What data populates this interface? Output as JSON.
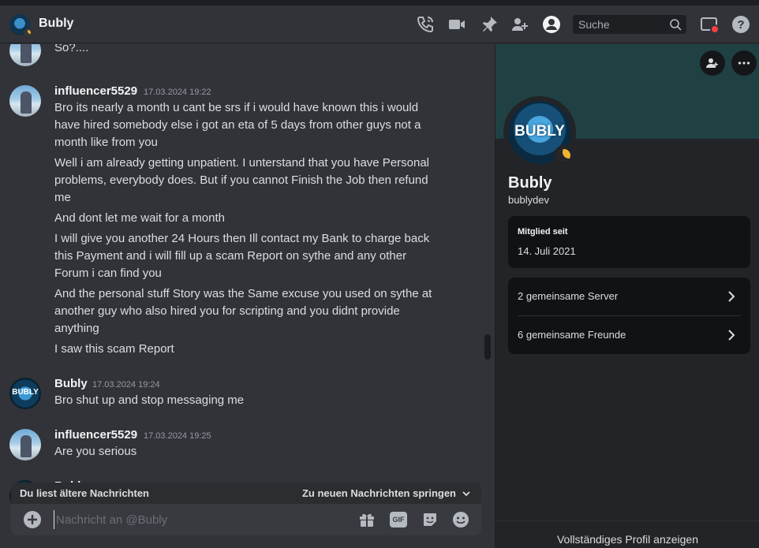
{
  "header": {
    "title": "Bubly",
    "search_placeholder": "Suche",
    "icons": [
      "voice-call-icon",
      "video-call-icon",
      "pin-icon",
      "add-friends-icon",
      "user-profile-icon",
      "search-icon",
      "inbox-icon",
      "help-icon"
    ]
  },
  "messages": [
    {
      "author": "influencer5529",
      "timestamp": "17.03.2024 19:22",
      "lines": [
        "Bro its nearly a month u cant be srs if i would have known this i would have hired somebody else i got an eta of 5 days from other guys not a month like from you",
        "Well i am already getting unpatient. I unterstand that you have Personal problems, everybody does. But if you cannot Finish the Job then refund me",
        "And dont let me wait for a month",
        "I will give you another 24 Hours then Ill contact my Bank to charge back this Payment and i will fill up a scam Report on sythe and any other Forum i can find you",
        "And the personal stuff Story was the Same excuse you used on sythe at another guy who also hired you for scripting and you didnt provide anything",
        "I saw this scam Report"
      ]
    },
    {
      "author": "Bubly",
      "timestamp": "17.03.2024 19:24",
      "lines": [
        "Bro shut up and stop messaging me"
      ]
    },
    {
      "author": "influencer5529",
      "timestamp": "17.03.2024 19:25",
      "lines": [
        "Are you serious"
      ]
    }
  ],
  "partial_top": {
    "text": "So?...."
  },
  "partial_bottom": {
    "author": "Bubly"
  },
  "avatar_text": "BUBLY",
  "older_bar": {
    "left": "Du liest ältere Nachrichten",
    "right": "Zu neuen Nachrichten springen"
  },
  "composer": {
    "placeholder": "Nachricht an @Bubly",
    "gif_label": "GIF"
  },
  "profile": {
    "name": "Bubly",
    "username": "bublydev",
    "member_since_label": "Mitglied seit",
    "member_since": "14. Juli 2021",
    "mutual_servers": "2 gemeinsame Server",
    "mutual_friends": "6 gemeinsame Freunde",
    "full_profile_link": "Vollständiges Profil anzeigen"
  },
  "colors": {
    "accent_status": "#f0b232",
    "banner": "#1f4144",
    "notification": "#f23f43"
  }
}
